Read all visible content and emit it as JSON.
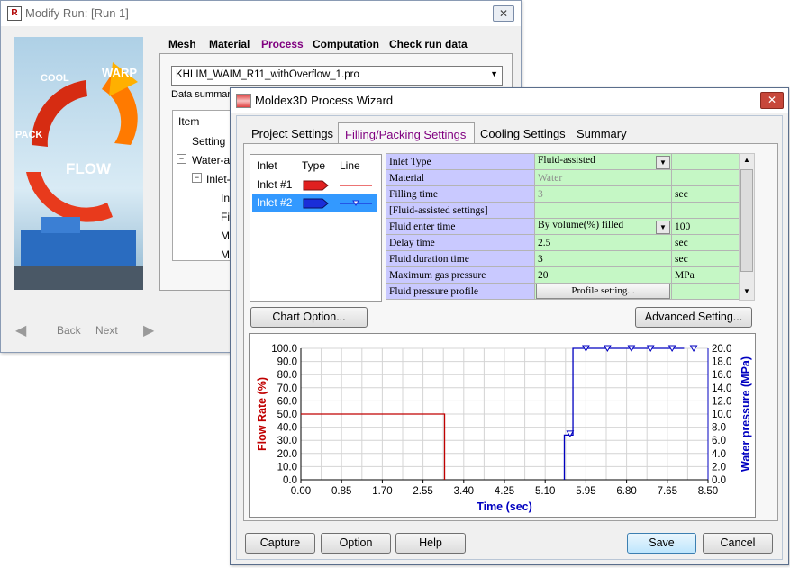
{
  "back_window": {
    "title": "Modify Run: [Run 1]",
    "tabs": [
      "Mesh",
      "Material",
      "Process",
      "Computation",
      "Check run data"
    ],
    "active_tab": "Process",
    "project_file": "KHLIM_WAIM_R11_withOverflow_1.pro",
    "data_summary_label": "Data summary",
    "tree_header": "Item",
    "tree_items": [
      "Setting",
      "Water-as",
      "Inlet-",
      "In",
      "Fil",
      "M",
      "M"
    ],
    "banner_words": [
      "COOL",
      "WARP",
      "PACK",
      "FLOW"
    ],
    "nav": {
      "back": "Back",
      "next": "Next"
    }
  },
  "wizard": {
    "title": "Moldex3D Process Wizard",
    "tabs": [
      "Project Settings",
      "Filling/Packing Settings",
      "Cooling Settings",
      "Summary"
    ],
    "active_tab": "Filling/Packing Settings",
    "inlet_columns": [
      "Inlet",
      "Type",
      "Line"
    ],
    "inlets": [
      {
        "name": "Inlet #1",
        "color": "#e02020",
        "selected": false
      },
      {
        "name": "Inlet #2",
        "color": "#1a2ed8",
        "selected": true
      }
    ],
    "params": [
      {
        "label": "Inlet Type",
        "value": "Fluid-assisted",
        "unit": "",
        "dropdown": true,
        "gray": false
      },
      {
        "label": "Material",
        "value": "Water",
        "unit": "",
        "dropdown": false,
        "gray": true
      },
      {
        "label": "Filling time",
        "value": "3",
        "unit": "sec",
        "dropdown": false,
        "gray": true
      },
      {
        "label": "[Fluid-assisted settings]",
        "value": "",
        "unit": "",
        "dropdown": false,
        "gray": false
      },
      {
        "label": "Fluid enter time",
        "value": "By volume(%) filled",
        "unit": "100",
        "dropdown": true,
        "gray": false
      },
      {
        "label": "Delay time",
        "value": "2.5",
        "unit": "sec",
        "dropdown": false,
        "gray": false
      },
      {
        "label": "Fluid duration time",
        "value": "3",
        "unit": "sec",
        "dropdown": false,
        "gray": false
      },
      {
        "label": "Maximum gas pressure",
        "value": "20",
        "unit": "MPa",
        "dropdown": false,
        "gray": false
      },
      {
        "label": "Fluid pressure profile",
        "value": "Profile setting...",
        "unit": "",
        "dropdown": false,
        "gray": false
      }
    ],
    "chart_option_button": "Chart Option...",
    "advanced_button": "Advanced Setting...",
    "buttons": {
      "capture": "Capture",
      "option": "Option",
      "help": "Help",
      "save": "Save",
      "cancel": "Cancel"
    },
    "colors": {
      "flow": "#c00000",
      "pressure": "#0000c0",
      "selected_row": "#3399ff",
      "accent_tab": "#800080"
    }
  },
  "chart_data": {
    "type": "line",
    "xlabel": "Time (sec)",
    "ylabel": "Flow Rate (%)",
    "y2label": "Water pressure (MPa)",
    "xlim": [
      0,
      8.5
    ],
    "ylim": [
      0,
      100
    ],
    "y2lim": [
      0,
      20
    ],
    "x_ticks": [
      "0.00",
      "0.85",
      "1.70",
      "2.55",
      "3.40",
      "4.25",
      "5.10",
      "5.95",
      "6.80",
      "7.65",
      "8.50"
    ],
    "y_ticks": [
      "0.0",
      "10.0",
      "20.0",
      "30.0",
      "40.0",
      "50.0",
      "60.0",
      "70.0",
      "80.0",
      "90.0",
      "100.0"
    ],
    "y2_ticks": [
      "0.0",
      "2.0",
      "4.0",
      "6.0",
      "8.0",
      "10.0",
      "12.0",
      "14.0",
      "16.0",
      "18.0",
      "20.0"
    ],
    "grid": true,
    "series": [
      {
        "axis": "left",
        "color": "#c00000",
        "x": [
          0,
          3.0,
          3.0
        ],
        "y": [
          50,
          50,
          0
        ]
      },
      {
        "axis": "right",
        "color": "#0000c0",
        "x": [
          5.5,
          5.5,
          5.68,
          5.68,
          8.0
        ],
        "y": [
          0,
          6.8,
          6.8,
          20,
          20
        ],
        "markers": [
          [
            5.62,
            7.0
          ],
          [
            5.95,
            20
          ],
          [
            6.4,
            20
          ],
          [
            6.9,
            20
          ],
          [
            7.3,
            20
          ],
          [
            7.75,
            20
          ],
          [
            8.2,
            20
          ]
        ]
      }
    ]
  }
}
